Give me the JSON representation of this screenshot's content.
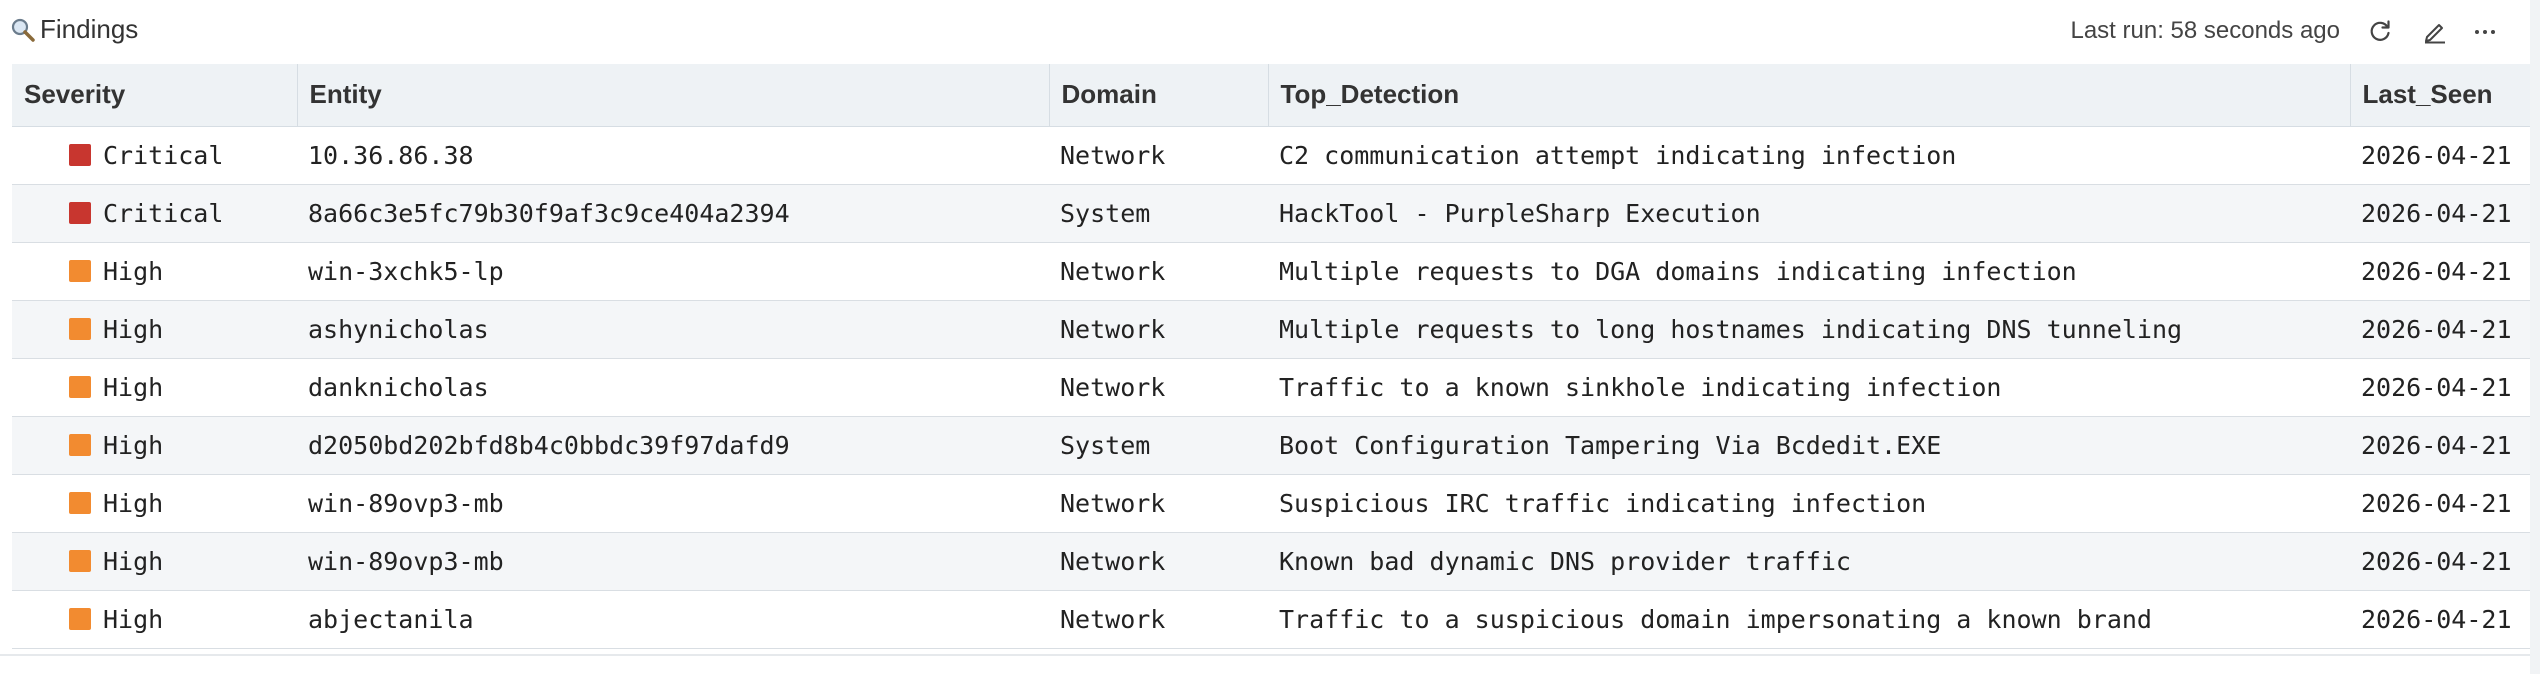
{
  "header": {
    "title": "Findings",
    "last_run": "Last run: 58 seconds ago"
  },
  "columns": [
    "Severity",
    "Entity",
    "Domain",
    "Top_Detection",
    "Last_Seen"
  ],
  "severity_colors": {
    "Critical": "#c8362f",
    "High": "#f28b30"
  },
  "rows": [
    {
      "severity": "Critical",
      "entity": "10.36.86.38",
      "domain": "Network",
      "detection": "C2 communication attempt indicating infection",
      "last_seen": "2026-04-21"
    },
    {
      "severity": "Critical",
      "entity": "8a66c3e5fc79b30f9af3c9ce404a2394",
      "domain": "System",
      "detection": "HackTool - PurpleSharp Execution",
      "last_seen": "2026-04-21"
    },
    {
      "severity": "High",
      "entity": "win-3xchk5-lp",
      "domain": "Network",
      "detection": "Multiple requests to DGA domains indicating infection",
      "last_seen": "2026-04-21"
    },
    {
      "severity": "High",
      "entity": "ashynicholas",
      "domain": "Network",
      "detection": "Multiple requests to long hostnames indicating DNS tunneling",
      "last_seen": "2026-04-21"
    },
    {
      "severity": "High",
      "entity": "danknicholas",
      "domain": "Network",
      "detection": "Traffic to a known sinkhole indicating infection",
      "last_seen": "2026-04-21"
    },
    {
      "severity": "High",
      "entity": "d2050bd202bfd8b4c0bbdc39f97dafd9",
      "domain": "System",
      "detection": "Boot Configuration Tampering Via Bcdedit.EXE",
      "last_seen": "2026-04-21"
    },
    {
      "severity": "High",
      "entity": "win-89ovp3-mb",
      "domain": "Network",
      "detection": "Suspicious IRC traffic indicating infection",
      "last_seen": "2026-04-21"
    },
    {
      "severity": "High",
      "entity": "win-89ovp3-mb",
      "domain": "Network",
      "detection": "Known bad dynamic DNS provider traffic",
      "last_seen": "2026-04-21"
    },
    {
      "severity": "High",
      "entity": "abjectanila",
      "domain": "Network",
      "detection": "Traffic to a suspicious domain impersonating a known brand",
      "last_seen": "2026-04-21"
    }
  ],
  "icons": {
    "title": "magnifier-icon",
    "refresh": "refresh-icon",
    "edit": "pencil-icon",
    "more": "more-icon"
  }
}
